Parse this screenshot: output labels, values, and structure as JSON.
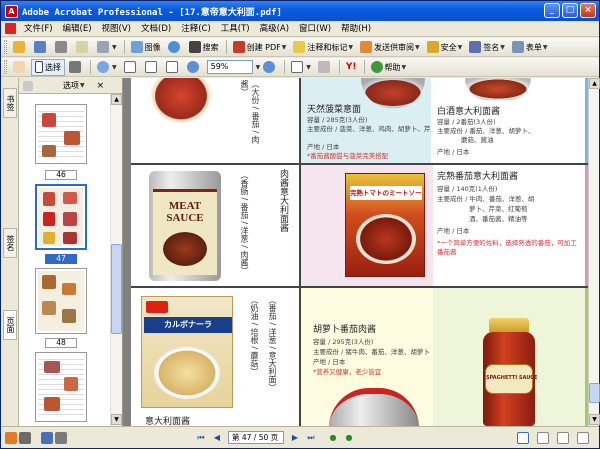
{
  "window": {
    "title": "Adobe Acrobat Professional - [17.意帝意大利面.pdf]",
    "app_icon": "pdf-app-icon"
  },
  "menu": [
    "文件(F)",
    "编辑(E)",
    "视图(V)",
    "文档(D)",
    "注释(C)",
    "工具(T)",
    "高级(A)",
    "窗口(W)",
    "帮助(H)"
  ],
  "toolbar1": {
    "items": [
      {
        "name": "open-icon",
        "label": ""
      },
      {
        "name": "save-icon",
        "label": ""
      },
      {
        "name": "print-icon",
        "label": ""
      },
      {
        "name": "email-icon",
        "label": ""
      },
      {
        "name": "attach-icon",
        "label": ""
      },
      {
        "name": "organizer-icon",
        "label": "图像"
      },
      {
        "name": "search-binoculars-icon",
        "label": "搜索"
      },
      {
        "name": "create-pdf-icon",
        "label": "创建 PDF"
      },
      {
        "name": "review-comment-icon",
        "label": "注释和标记"
      },
      {
        "name": "send-review-icon",
        "label": "发送供审阅"
      },
      {
        "name": "security-lock-icon",
        "label": "安全"
      },
      {
        "name": "sign-icon",
        "label": "签名"
      },
      {
        "name": "forms-icon",
        "label": "表单"
      }
    ]
  },
  "toolbar2": {
    "select_label": "选择",
    "zoom_value": "59%",
    "help_label": "帮助"
  },
  "left_panel": {
    "tabs": [
      "书签",
      "签名",
      "页面"
    ],
    "header_label": "选项",
    "close": "×",
    "thumbnails": [
      {
        "page": "46"
      },
      {
        "page": "47",
        "selected": true
      },
      {
        "page": "48"
      }
    ]
  },
  "document": {
    "products": [
      {
        "title": "天然菠菜意面",
        "lines": [
          "容量 / 285克(3人份)",
          "主要成份 / 菠菜、洋葱、鸡肉、胡萝卜、芹菜",
          "产地 / 日本"
        ],
        "note": "*番茄酱酸甜与菠菜完美搭配"
      },
      {
        "title": "白酒意大利面酱",
        "lines": [
          "容量 / 2番茄(3人份)",
          "主要成份 / 番茄、洋葱、胡萝卜、",
          "蘑菇、酱油",
          "产地 / 日本"
        ]
      },
      {
        "title": "完熟番茄意大利面酱",
        "lines": [
          "容量 / 140克(1人份)",
          "主要成份 / 牛肉、番茄、洋葱、胡",
          "萝卜、芹菜、红葡萄",
          "酒、番茄酱、精油等",
          "产地 / 日本"
        ],
        "note": "*一个简单方便的佐料，选择熟透的番茄，可加工番茄酱"
      },
      {
        "title": "胡萝卜番茄肉酱",
        "lines": [
          "容量 / 295克(3人份)",
          "主要成份 / 猪牛肉、番茄、洋葱、胡萝卜",
          "产地 / 日本"
        ],
        "note": "*营养又健康，老少皆宜"
      },
      {
        "title": "肉酱意大利面酱",
        "lines": [
          "容量 / 295克",
          "主要成份 / 牛肉、番茄、洋葱、胡萝卜、大蒜",
          "产地 / 日本"
        ]
      },
      {
        "title": "意大利面酱",
        "lines": []
      }
    ],
    "can_label_meat": "MEAT SAUCE",
    "box_label_jp": "完熟トマトのミートソース",
    "carbonara_label": "カルボナーラ",
    "jar_label": "SPAGHETTI SAUCE"
  },
  "statusbar": {
    "page_box": "第 47 / 50 页"
  },
  "colors": {
    "title_blue": "#0a5ce0",
    "selection": "#316ac5",
    "cell_blue": "#dbeff3",
    "cell_pink": "#f6e4ee",
    "cell_yellow": "#fdfbe0",
    "cell_green": "#eef5d8"
  }
}
